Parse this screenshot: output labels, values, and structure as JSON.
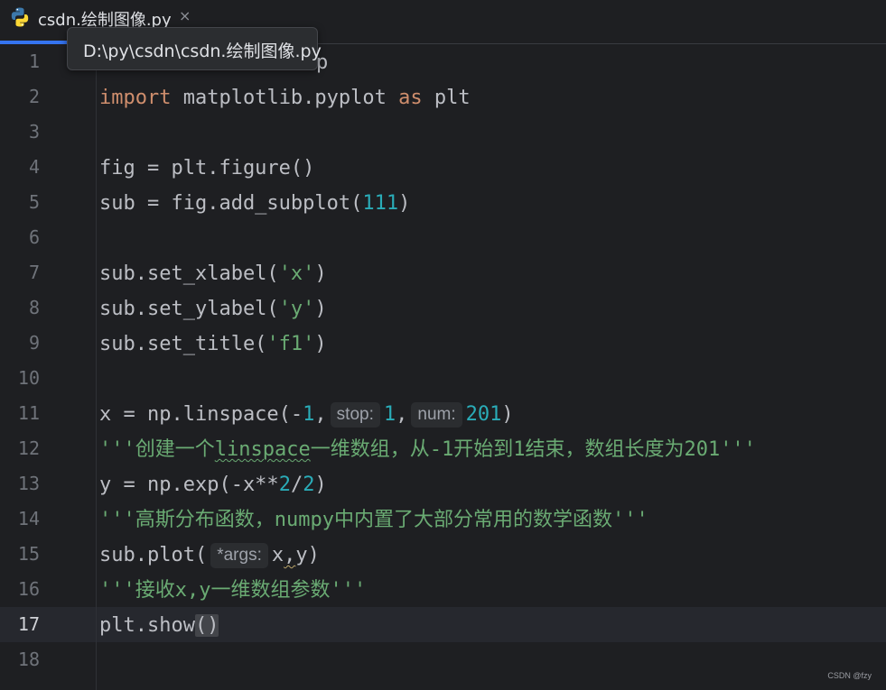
{
  "tab": {
    "label": "csdn.绘制图像.py",
    "close_icon": "×",
    "icon": "python-file-icon",
    "accent_color": "#3574f0"
  },
  "tooltip": {
    "text": "D:\\py\\csdn\\csdn.绘制图像.py"
  },
  "line_numbers": [
    "1",
    "2",
    "3",
    "4",
    "5",
    "6",
    "7",
    "8",
    "9",
    "10",
    "11",
    "12",
    "13",
    "14",
    "15",
    "16",
    "17",
    "18"
  ],
  "current_line": 17,
  "code": {
    "l1_rest": "p",
    "l2_kw1": "import",
    "l2_mid": " matplotlib.pyplot ",
    "l2_kw2": "as",
    "l2_end": " plt",
    "l4": "fig = plt.figure()",
    "l5_a": "sub = fig.add_subplot(",
    "l5_num": "111",
    "l5_b": ")",
    "l7_a": "sub.set_xlabel(",
    "l7_str": "'x'",
    "l7_b": ")",
    "l8_a": "sub.set_ylabel(",
    "l8_str": "'y'",
    "l8_b": ")",
    "l9_a": "sub.set_title(",
    "l9_str": "'f1'",
    "l9_b": ")",
    "l11_a": "x = np.linspace(-",
    "l11_n1": "1",
    "l11_comma1": ",",
    "l11_hint1": "stop:",
    "l11_n2": "1",
    "l11_comma2": ",",
    "l11_hint2": "num:",
    "l11_n3": "201",
    "l11_b": ")",
    "l12_a": "'''创建一个",
    "l12_sq": "linspace",
    "l12_b": "一维数组，从-1开始到1结束，数组长度为201'''",
    "l13_a": "y = np.exp(-x**",
    "l13_n1": "2",
    "l13_slash": "/",
    "l13_n2": "2",
    "l13_b": ")",
    "l14": "'''高斯分布函数，numpy中内置了大部分常用的数学函数'''",
    "l15_a": "sub.plot(",
    "l15_hint": "*args:",
    "l15_x": "x",
    "l15_comma": ",",
    "l15_b": "y)",
    "l16": "'''接收x,y一维数组参数'''",
    "l17_a": "plt.show",
    "l17_paren": "()"
  },
  "colors": {
    "background": "#1e1f22",
    "keyword": "#cf8e6d",
    "number": "#2aacb8",
    "string": "#6aab73",
    "text": "#bcbec4"
  },
  "watermark": "CSDN @fzy"
}
